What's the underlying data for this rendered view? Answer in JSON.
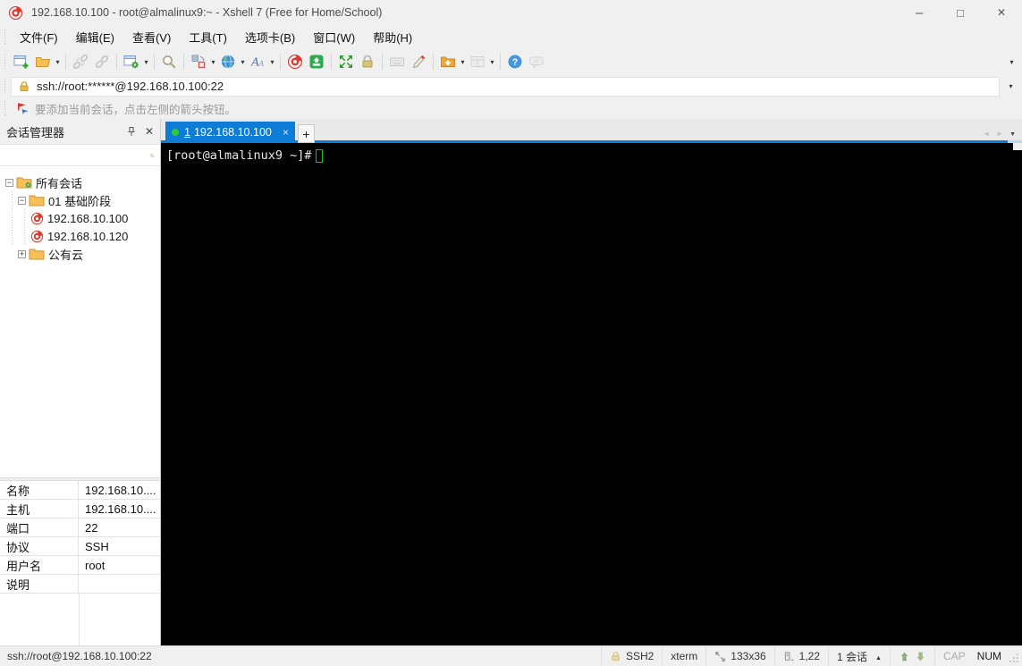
{
  "window": {
    "title": "192.168.10.100 - root@almalinux9:~ - Xshell 7 (Free for Home/School)"
  },
  "menu": {
    "items": [
      "文件(F)",
      "编辑(E)",
      "查看(V)",
      "工具(T)",
      "选项卡(B)",
      "窗口(W)",
      "帮助(H)"
    ]
  },
  "toolbar": {
    "icons": [
      "new-session",
      "open-session",
      "disconnect",
      "reconnect",
      "session-properties",
      "find",
      "tile-layout",
      "web-browser",
      "font",
      "xshell",
      "xftp",
      "fullscreen",
      "lock-screen",
      "virtual-keyboard",
      "highlight",
      "new-session-folder",
      "pane-layout",
      "help",
      "feedback"
    ]
  },
  "address_bar": {
    "value": "ssh://root:******@192.168.10.100:22"
  },
  "info_bar": {
    "message": "要添加当前会话，点击左侧的箭头按钮。"
  },
  "session_manager": {
    "title": "会话管理器",
    "search_value": "",
    "tree": {
      "all_sessions": "所有会话",
      "folder_basic": "01 基础阶段",
      "session_100": "192.168.10.100",
      "session_120": "192.168.10.120",
      "folder_cloud": "公有云"
    }
  },
  "properties": {
    "rows": [
      {
        "label": "名称",
        "value": "192.168.10...."
      },
      {
        "label": "主机",
        "value": "192.168.10...."
      },
      {
        "label": "端口",
        "value": "22"
      },
      {
        "label": "协议",
        "value": "SSH"
      },
      {
        "label": "用户名",
        "value": "root"
      },
      {
        "label": "说明",
        "value": ""
      }
    ]
  },
  "tab_bar": {
    "active_tab": {
      "number": "1",
      "label": "192.168.10.100"
    }
  },
  "terminal": {
    "prompt": "[root@almalinux9 ~]#"
  },
  "status_bar": {
    "connection": "ssh://root@192.168.10.100:22",
    "protocol": "SSH2",
    "terminal_type": "xterm",
    "size": "133x36",
    "cursor_position": "1,22",
    "session_count": "1 会话",
    "caps_lock": "CAP",
    "num_lock": "NUM"
  },
  "colors": {
    "accent_blue": "#0c7cd6",
    "terminal_bg": "#000000",
    "cursor_green": "#19c319",
    "xshell_red": "#dd3b2f",
    "folder_yellow": "#f6c057"
  }
}
